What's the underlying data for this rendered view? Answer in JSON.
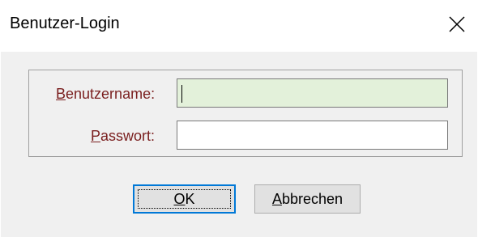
{
  "window": {
    "title": "Benutzer-Login",
    "close_icon": "close-icon"
  },
  "form": {
    "username_label_prefix": "B",
    "username_label_rest": "enutzername:",
    "username_value": "",
    "password_label_prefix": "P",
    "password_label_rest": "asswort:",
    "password_value": "",
    "active_field_color": "#e3f1da",
    "label_color": "#7a1f1f"
  },
  "buttons": {
    "ok_prefix": "O",
    "ok_rest": "K",
    "cancel_prefix": "A",
    "cancel_rest": "bbrechen",
    "default_border_color": "#0078d7"
  }
}
